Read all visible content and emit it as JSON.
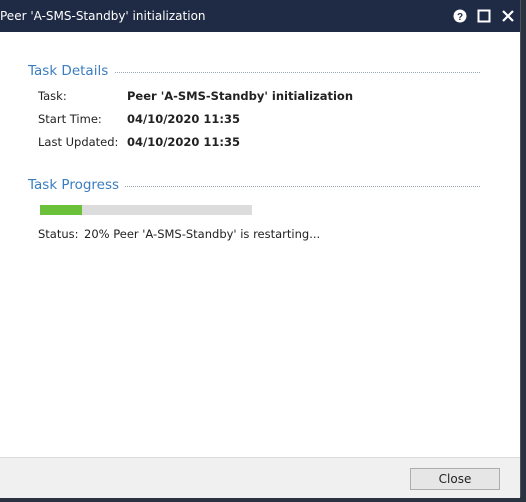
{
  "window": {
    "title": "Peer 'A-SMS-Standby' initialization"
  },
  "titlebar_icons": [
    "help-icon",
    "maximize-icon",
    "close-icon"
  ],
  "task_details": {
    "heading": "Task Details",
    "rows": [
      {
        "label": "Task:",
        "value": "Peer 'A-SMS-Standby' initialization"
      },
      {
        "label": "Start Time:",
        "value": "04/10/2020 11:35"
      },
      {
        "label": "Last Updated:",
        "value": "04/10/2020 11:35"
      }
    ]
  },
  "task_progress": {
    "heading": "Task Progress",
    "percent": 20,
    "status_label": "Status:",
    "status_text": "20%  Peer 'A-SMS-Standby' is restarting..."
  },
  "footer": {
    "close_label": "Close"
  },
  "colors": {
    "titlebar": "#1f2a44",
    "heading": "#3a7dbf",
    "progress_fill": "#6cc13a",
    "progress_track": "#dcdcdc"
  }
}
